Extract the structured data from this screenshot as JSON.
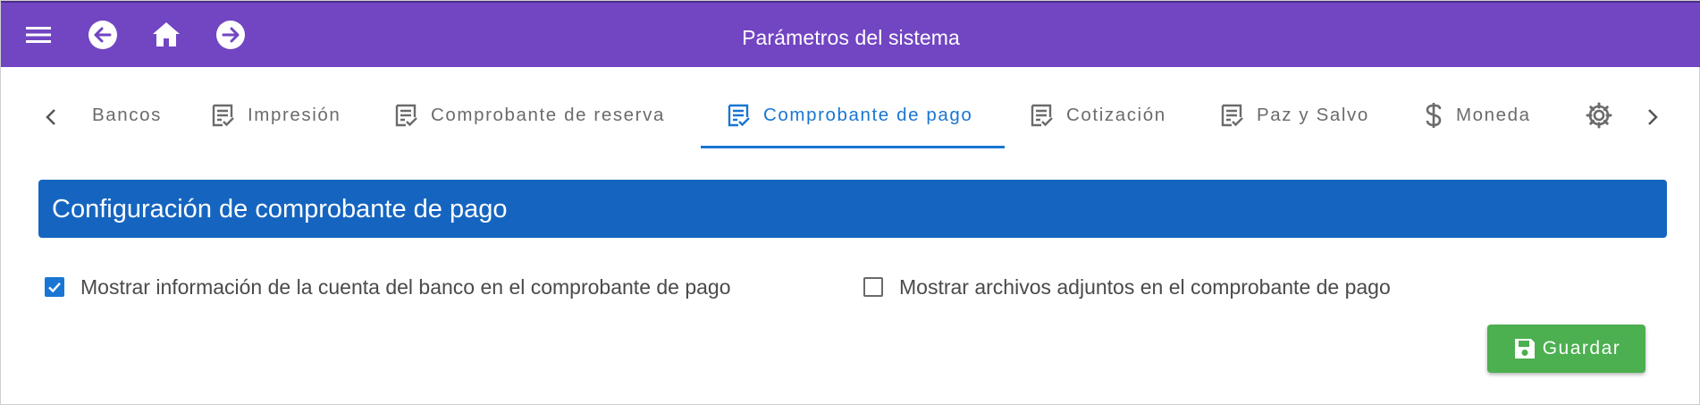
{
  "app_bar": {
    "title": "Parámetros del sistema",
    "icons": [
      "menu-icon",
      "back-icon",
      "home-icon",
      "forward-icon"
    ]
  },
  "tabs": [
    {
      "label": "Bancos",
      "icon": "",
      "active": false
    },
    {
      "label": "Impresión",
      "icon": "document-check-icon",
      "active": false
    },
    {
      "label": "Comprobante de reserva",
      "icon": "document-check-icon",
      "active": false
    },
    {
      "label": "Comprobante de pago",
      "icon": "document-check-icon",
      "active": true
    },
    {
      "label": "Cotización",
      "icon": "document-check-icon",
      "active": false
    },
    {
      "label": "Paz y Salvo",
      "icon": "document-check-icon",
      "active": false
    },
    {
      "label": "Moneda",
      "icon": "dollar-icon",
      "active": false
    },
    {
      "label": "",
      "icon": "gear-icon",
      "active": false
    }
  ],
  "section": {
    "title": "Configuración de comprobante de pago"
  },
  "options": [
    {
      "label": "Mostrar información de la cuenta del banco en el comprobante de pago",
      "checked": true
    },
    {
      "label": "Mostrar archivos adjuntos en el comprobante de pago",
      "checked": false
    }
  ],
  "actions": {
    "save_label": "Guardar"
  },
  "colors": {
    "app_bar": "#7245c2",
    "accent": "#1976d2",
    "section_header": "#1565c0",
    "save_button": "#4caf50",
    "inactive_tab": "#6b6b6b"
  }
}
